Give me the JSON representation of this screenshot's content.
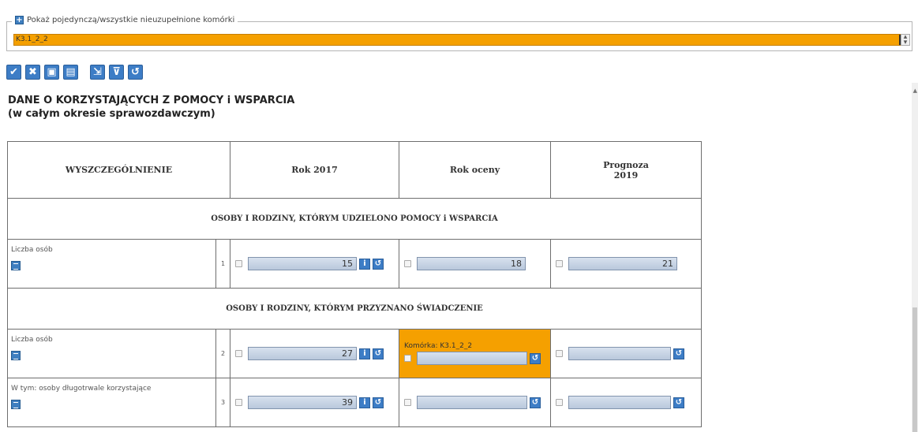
{
  "filter": {
    "legend": "Pokaż pojedynczą/wszystkie nieuzupełnione komórki",
    "selected_value": "K3.1_2_2"
  },
  "toolbar": {
    "buttons": [
      {
        "icon": "check-icon",
        "glyph": "✔"
      },
      {
        "icon": "close-icon",
        "glyph": "✖"
      },
      {
        "icon": "save-icon",
        "glyph": "▣"
      },
      {
        "icon": "save-all-icon",
        "glyph": "▤"
      },
      {
        "icon": "export-icon",
        "glyph": "⇲"
      },
      {
        "icon": "filter-icon",
        "glyph": "⊽"
      },
      {
        "icon": "refresh-icon",
        "glyph": "↺"
      }
    ]
  },
  "title": {
    "line1": "DANE O KORZYSTAJĄCYCH Z POMOCY i WSPARCIA",
    "line2": "(w całym okresie sprawozdawczym)"
  },
  "table": {
    "headers": [
      "WYSZCZEGÓLNIENIE",
      "Rok 2017",
      "Rok oceny",
      "Prognoza 2019"
    ],
    "sections": [
      {
        "title": "OSOBY I RODZINY, KTÓRYM UDZIELONO POMOCY i WSPARCIA",
        "rows": [
          {
            "label": "Liczba osób",
            "num": "1",
            "rok2017": "15",
            "rok_oceny": "18",
            "prognoza": "21"
          }
        ]
      },
      {
        "title": "OSOBY I RODZINY, KTÓRYM PRZYZNANO ŚWIADCZENIE",
        "rows": [
          {
            "label": "Liczba osób",
            "num": "2",
            "rok2017": "27",
            "rok_oceny": "",
            "prognoza": "",
            "highlight_label": "Komórka: K3.1_2_2"
          },
          {
            "label": "W tym: osoby długotrwale korzystające",
            "num": "3",
            "rok2017": "39",
            "rok_oceny": "",
            "prognoza": ""
          }
        ]
      }
    ]
  },
  "colors": {
    "highlight": "#f5a000",
    "button_blue": "#3d7dc6"
  }
}
